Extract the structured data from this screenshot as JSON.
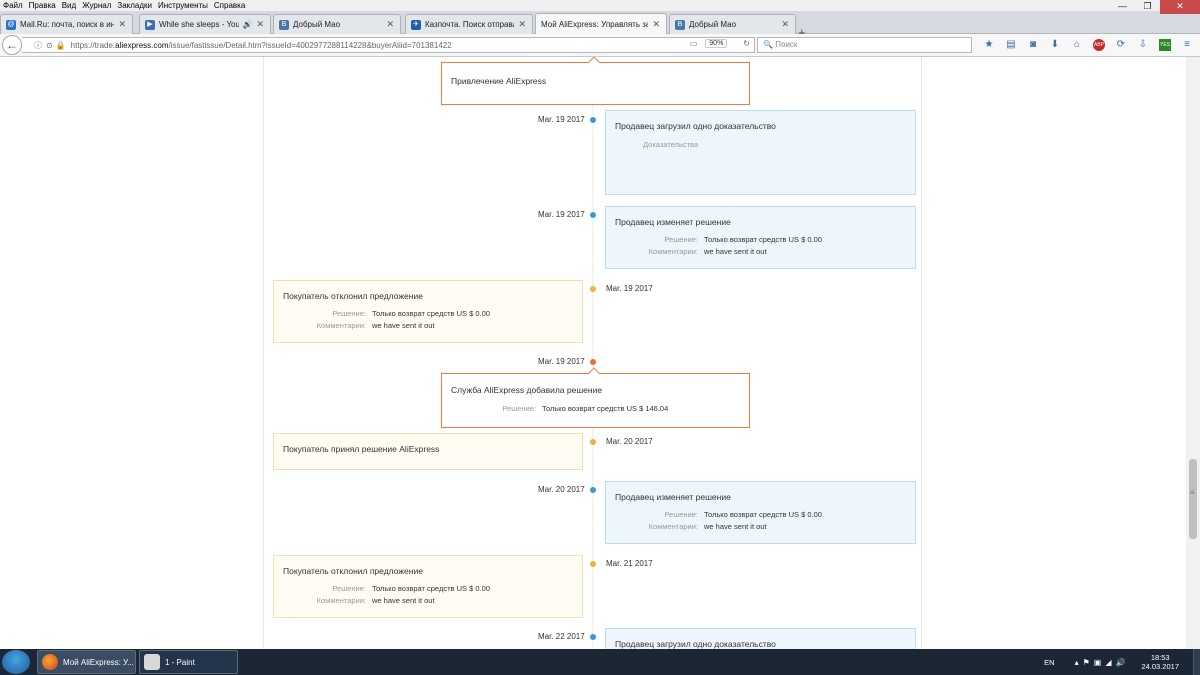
{
  "menu": [
    "Файл",
    "Правка",
    "Вид",
    "Журнал",
    "Закладки",
    "Инструменты",
    "Справка"
  ],
  "tabs": [
    {
      "title": "Mail.Ru: почта, поиск в ин...",
      "icon": "mailru-icon",
      "active": false
    },
    {
      "title": "While she sleeps - You ...",
      "icon": "youtube-icon",
      "active": false,
      "audio": true
    },
    {
      "title": "Добрый Мао",
      "icon": "vk-icon",
      "active": false
    },
    {
      "title": "Казпочта. Поиск отправл...",
      "icon": "kazpost-icon",
      "active": false
    },
    {
      "title": "Мой AliExpress: Управлять зак...",
      "icon": "aliexpress-icon",
      "active": true
    },
    {
      "title": "Добрый Мао",
      "icon": "vk-icon",
      "active": false
    }
  ],
  "new_tab_glyph": "+",
  "nav": {
    "url_host": "https://trade.",
    "url_domain": "aliexpress.com",
    "url_path": "/issue/fastissue/Detail.htm?issueId=4002977288114228&buyerAliid=701381422",
    "zoom": "90%",
    "search_placeholder": "Поиск"
  },
  "abp_label": "ABP",
  "yes_label": "YES",
  "colors": {
    "seller": "#3a9ad9",
    "buyer": "#f0b23a",
    "aliexpress": "#f06c2a"
  },
  "timeline": {
    "top_event": {
      "title": "Привлечение AliExpress"
    },
    "events": [
      {
        "side": "seller",
        "date": "Mar. 19 2017",
        "title": "Продавец загрузил одно доказательство",
        "evidence_label": "Доказательства"
      },
      {
        "side": "seller",
        "date": "Mar. 19 2017",
        "title": "Продавец изменяет решение",
        "decision_label": "Решение:",
        "decision": "Только возврат средств US $ 0.00",
        "comment_label": "Комментарии:",
        "comment": "we have sent it out"
      },
      {
        "side": "buyer",
        "date": "Mar. 19 2017",
        "title": "Покупатель отклонил предложение",
        "decision_label": "Решение:",
        "decision": "Только возврат средств US $ 0.00",
        "comment_label": "Комментарии:",
        "comment": "we have sent it out"
      },
      {
        "side": "aliexpress",
        "date": "Mar. 19 2017",
        "title": "Служба AliExpress добавила решение",
        "decision_label": "Решение:",
        "decision": "Только возврат средств US $ 146.04"
      },
      {
        "side": "buyer",
        "date": "Mar. 20 2017",
        "title": "Покупатель принял решение AliExpress"
      },
      {
        "side": "seller",
        "date": "Mar. 20 2017",
        "title": "Продавец изменяет решение",
        "decision_label": "Решение:",
        "decision": "Только возврат средств US $ 0.00",
        "comment_label": "Комментарии:",
        "comment": "we have sent it out"
      },
      {
        "side": "buyer",
        "date": "Mar. 21 2017",
        "title": "Покупатель отклонил предложение",
        "decision_label": "Решение:",
        "decision": "Только возврат средств US $ 0.00",
        "comment_label": "Комментарии:",
        "comment": "we have sent it out"
      },
      {
        "side": "seller",
        "date": "Mar. 22 2017",
        "title": "Продавец загрузил одно доказательство"
      }
    ]
  },
  "taskbar": {
    "items": [
      {
        "label": "Мой AliExpress: У...",
        "icon": "firefox-icon"
      },
      {
        "label": "1 - Paint",
        "icon": "paint-icon"
      }
    ],
    "lang": "EN",
    "time": "18:53",
    "date": "24.03.2017"
  }
}
